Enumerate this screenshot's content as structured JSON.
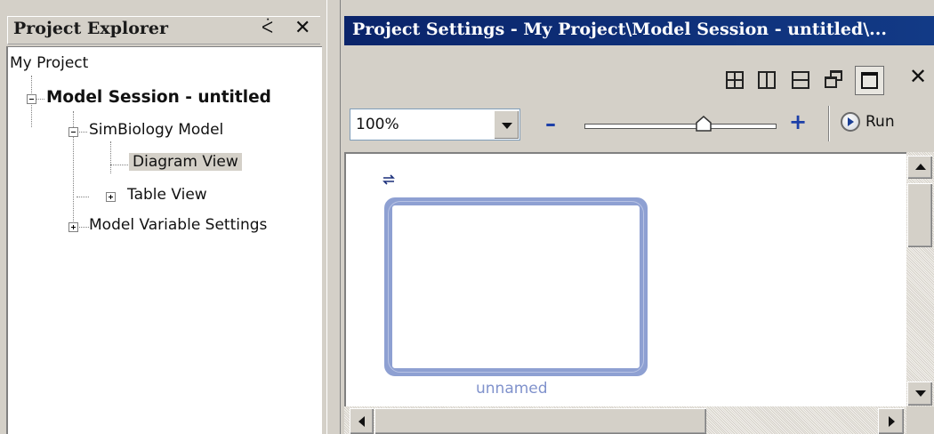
{
  "project_explorer": {
    "title": "Project Explorer",
    "pin_glyph": "ᐹ",
    "close_glyph": "✕",
    "tree": {
      "root": "My Project",
      "session": "Model Session - untitled",
      "model": "SimBiology Model",
      "diagram_view": "Diagram View",
      "table_view": "Table View",
      "variable_settings": "Model Variable Settings"
    }
  },
  "settings_window": {
    "title": "Project Settings - My Project\\Model Session - untitled\\...",
    "close_glyph": "✕",
    "zoom_value": "100%",
    "zoom_level": 0.62,
    "minus_glyph": "–",
    "plus_glyph": "+",
    "run_label": "Run"
  },
  "diagram": {
    "compartment_name": "unnamed"
  },
  "colors": {
    "title_bar": "#0a246a",
    "compartment_border": "#8ea0d2",
    "zoom_signs": "#1c3fa8"
  }
}
